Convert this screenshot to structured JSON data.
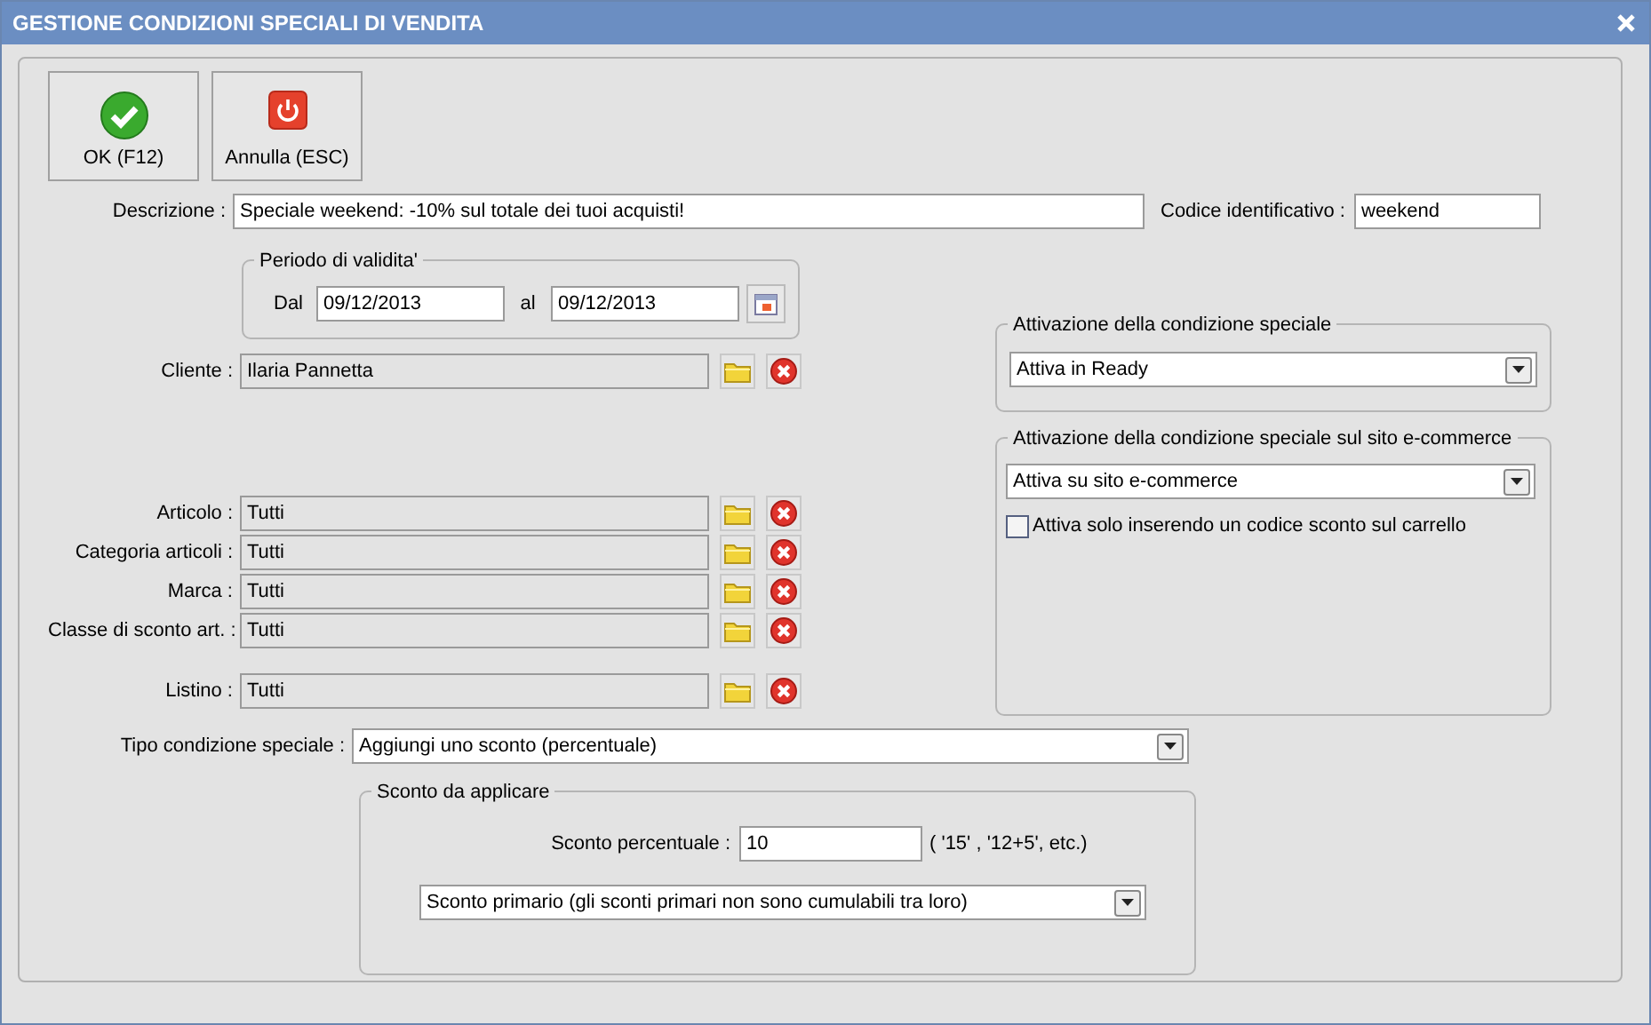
{
  "window": {
    "title": "GESTIONE CONDIZIONI SPECIALI DI VENDITA"
  },
  "buttons": [
    {
      "label": "OK (F12)",
      "kind": "ok"
    },
    {
      "label": "Annulla (ESC)",
      "kind": "cancel"
    }
  ],
  "description": {
    "label": "Descrizione :",
    "value": "Speciale weekend: -10% sul totale dei tuoi acquisti!"
  },
  "code": {
    "label": "Codice identificativo :",
    "value": "weekend"
  },
  "validity": {
    "title": "Periodo di validita'",
    "from_label": "Dal",
    "from": "09/12/2013",
    "to_label": "al",
    "to": "09/12/2013"
  },
  "client": {
    "label": "Cliente :",
    "value": "Ilaria Pannetta"
  },
  "filters": [
    {
      "label": "Articolo :",
      "value": "Tutti"
    },
    {
      "label": "Categoria articoli :",
      "value": "Tutti"
    },
    {
      "label": "Marca :",
      "value": "Tutti"
    },
    {
      "label": "Classe di sconto art. :",
      "value": "Tutti"
    }
  ],
  "price_list": {
    "label": "Listino :",
    "value": "Tutti"
  },
  "activation": {
    "title": "Attivazione della condizione speciale",
    "value": "Attiva in Ready"
  },
  "ecommerce": {
    "title": "Attivazione della condizione speciale sul sito e-commerce",
    "value": "Attiva su sito e-commerce",
    "checkbox": {
      "label": "Attiva solo inserendo un codice sconto sul carrello",
      "checked": false
    }
  },
  "type": {
    "label": "Tipo condizione speciale :",
    "value": "Aggiungi uno sconto (percentuale)"
  },
  "discount": {
    "title": "Sconto da applicare",
    "label": "Sconto percentuale :",
    "value": "10",
    "hint": "( '15' ,  '12+5', etc.)",
    "mode": "Sconto primario (gli sconti primari non sono cumulabili tra loro)"
  }
}
